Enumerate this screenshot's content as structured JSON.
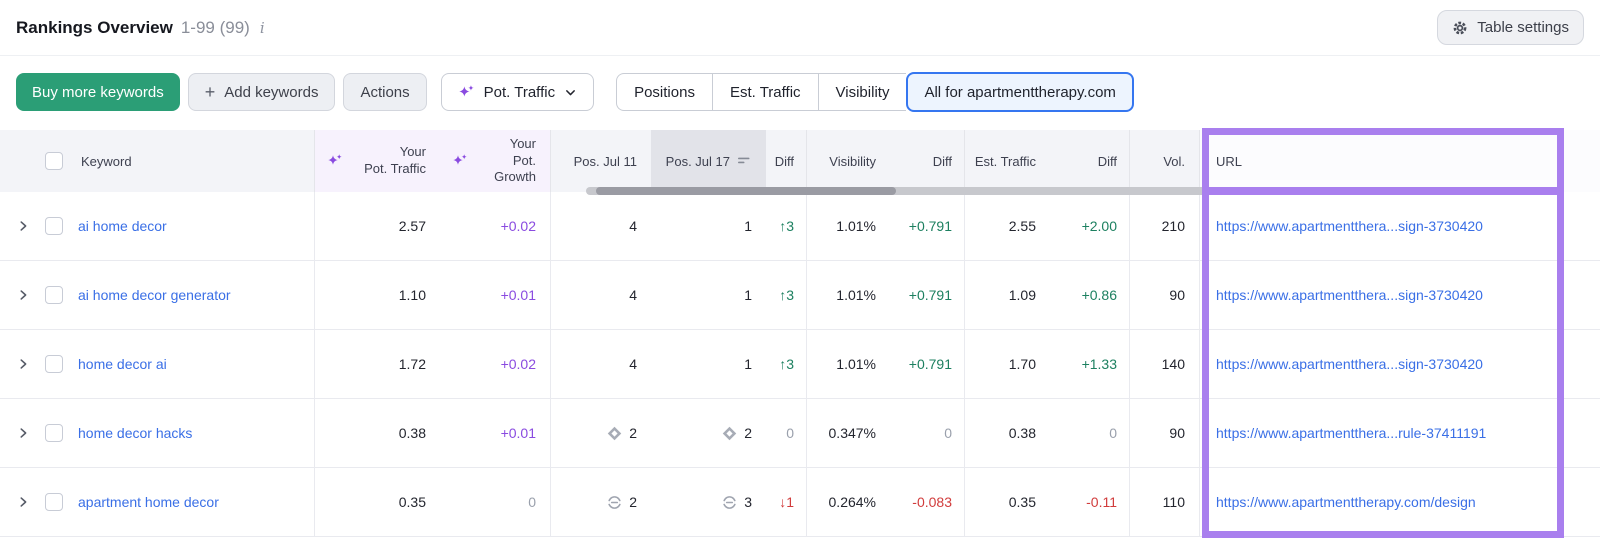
{
  "header": {
    "title": "Rankings Overview",
    "range": "1-99 (99)",
    "table_settings_label": "Table settings"
  },
  "toolbar": {
    "buy_button": "Buy more keywords",
    "add_button": "Add keywords",
    "actions_button": "Actions",
    "metric_dropdown": "Pot. Traffic",
    "view_tabs": [
      "Positions",
      "Est. Traffic",
      "Visibility",
      "All for apartmenttherapy.com"
    ],
    "selected_tab": "All for apartmenttherapy.com"
  },
  "table": {
    "columns": {
      "keyword": "Keyword",
      "pot_traffic_line1": "Your",
      "pot_traffic_line2": "Pot. Traffic",
      "pot_growth_line1": "Your",
      "pot_growth_line2": "Pot. Growth",
      "pos_jul11": "Pos. Jul 11",
      "pos_jul17": "Pos. Jul 17",
      "diff": "Diff",
      "visibility": "Visibility",
      "est_traffic": "Est. Traffic",
      "vol": "Vol.",
      "url": "URL"
    },
    "rows": [
      {
        "keyword": "ai home decor",
        "pot_traffic": "2.57",
        "pot_growth": {
          "text": "+0.02",
          "tone": "purple"
        },
        "pos_jul11": {
          "value": "4",
          "icon": null
        },
        "pos_jul17": {
          "value": "1",
          "icon": null
        },
        "pos_diff": {
          "text": "↑3",
          "tone": "positive"
        },
        "visibility": "1.01%",
        "visibility_diff": {
          "text": "+0.791",
          "tone": "positive"
        },
        "est_traffic": "2.55",
        "est_traffic_diff": {
          "text": "+2.00",
          "tone": "positive"
        },
        "volume": "210",
        "url": "https://www.apartmentthera...sign-3730420"
      },
      {
        "keyword": "ai home decor generator",
        "pot_traffic": "1.10",
        "pot_growth": {
          "text": "+0.01",
          "tone": "purple"
        },
        "pos_jul11": {
          "value": "4",
          "icon": null
        },
        "pos_jul17": {
          "value": "1",
          "icon": null
        },
        "pos_diff": {
          "text": "↑3",
          "tone": "positive"
        },
        "visibility": "1.01%",
        "visibility_diff": {
          "text": "+0.791",
          "tone": "positive"
        },
        "est_traffic": "1.09",
        "est_traffic_diff": {
          "text": "+0.86",
          "tone": "positive"
        },
        "volume": "90",
        "url": "https://www.apartmentthera...sign-3730420"
      },
      {
        "keyword": "home decor ai",
        "pot_traffic": "1.72",
        "pot_growth": {
          "text": "+0.02",
          "tone": "purple"
        },
        "pos_jul11": {
          "value": "4",
          "icon": null
        },
        "pos_jul17": {
          "value": "1",
          "icon": null
        },
        "pos_diff": {
          "text": "↑3",
          "tone": "positive"
        },
        "visibility": "1.01%",
        "visibility_diff": {
          "text": "+0.791",
          "tone": "positive"
        },
        "est_traffic": "1.70",
        "est_traffic_diff": {
          "text": "+1.33",
          "tone": "positive"
        },
        "volume": "140",
        "url": "https://www.apartmentthera...sign-3730420"
      },
      {
        "keyword": "home decor hacks",
        "pot_traffic": "0.38",
        "pot_growth": {
          "text": "+0.01",
          "tone": "purple"
        },
        "pos_jul11": {
          "value": "2",
          "icon": "serp-feature-icon"
        },
        "pos_jul17": {
          "value": "2",
          "icon": "serp-feature-icon"
        },
        "pos_diff": {
          "text": "0",
          "tone": "neutral"
        },
        "visibility": "0.347%",
        "visibility_diff": {
          "text": "0",
          "tone": "neutral"
        },
        "est_traffic": "0.38",
        "est_traffic_diff": {
          "text": "0",
          "tone": "neutral"
        },
        "volume": "90",
        "url": "https://www.apartmentthera...rule-37411191"
      },
      {
        "keyword": "apartment home decor",
        "pot_traffic": "0.35",
        "pot_growth": {
          "text": "0",
          "tone": "neutral"
        },
        "pos_jul11": {
          "value": "2",
          "icon": "link-icon"
        },
        "pos_jul17": {
          "value": "3",
          "icon": "link-icon"
        },
        "pos_diff": {
          "text": "↓1",
          "tone": "negative"
        },
        "visibility": "0.264%",
        "visibility_diff": {
          "text": "-0.083",
          "tone": "negative"
        },
        "est_traffic": "0.35",
        "est_traffic_diff": {
          "text": "-0.11",
          "tone": "negative"
        },
        "volume": "110",
        "url": "https://www.apartmenttherapy.com/design"
      }
    ]
  },
  "colors": {
    "brand_green": "#2b9e76",
    "link_blue": "#3a6fe6",
    "growth_purple": "#8a4be0",
    "positive_green": "#1d8060",
    "negative_red": "#d13c3c",
    "neutral_gray": "#9aa0ac",
    "highlight_purple": "#a97fee",
    "selected_tab_blue": "#3576f0"
  }
}
